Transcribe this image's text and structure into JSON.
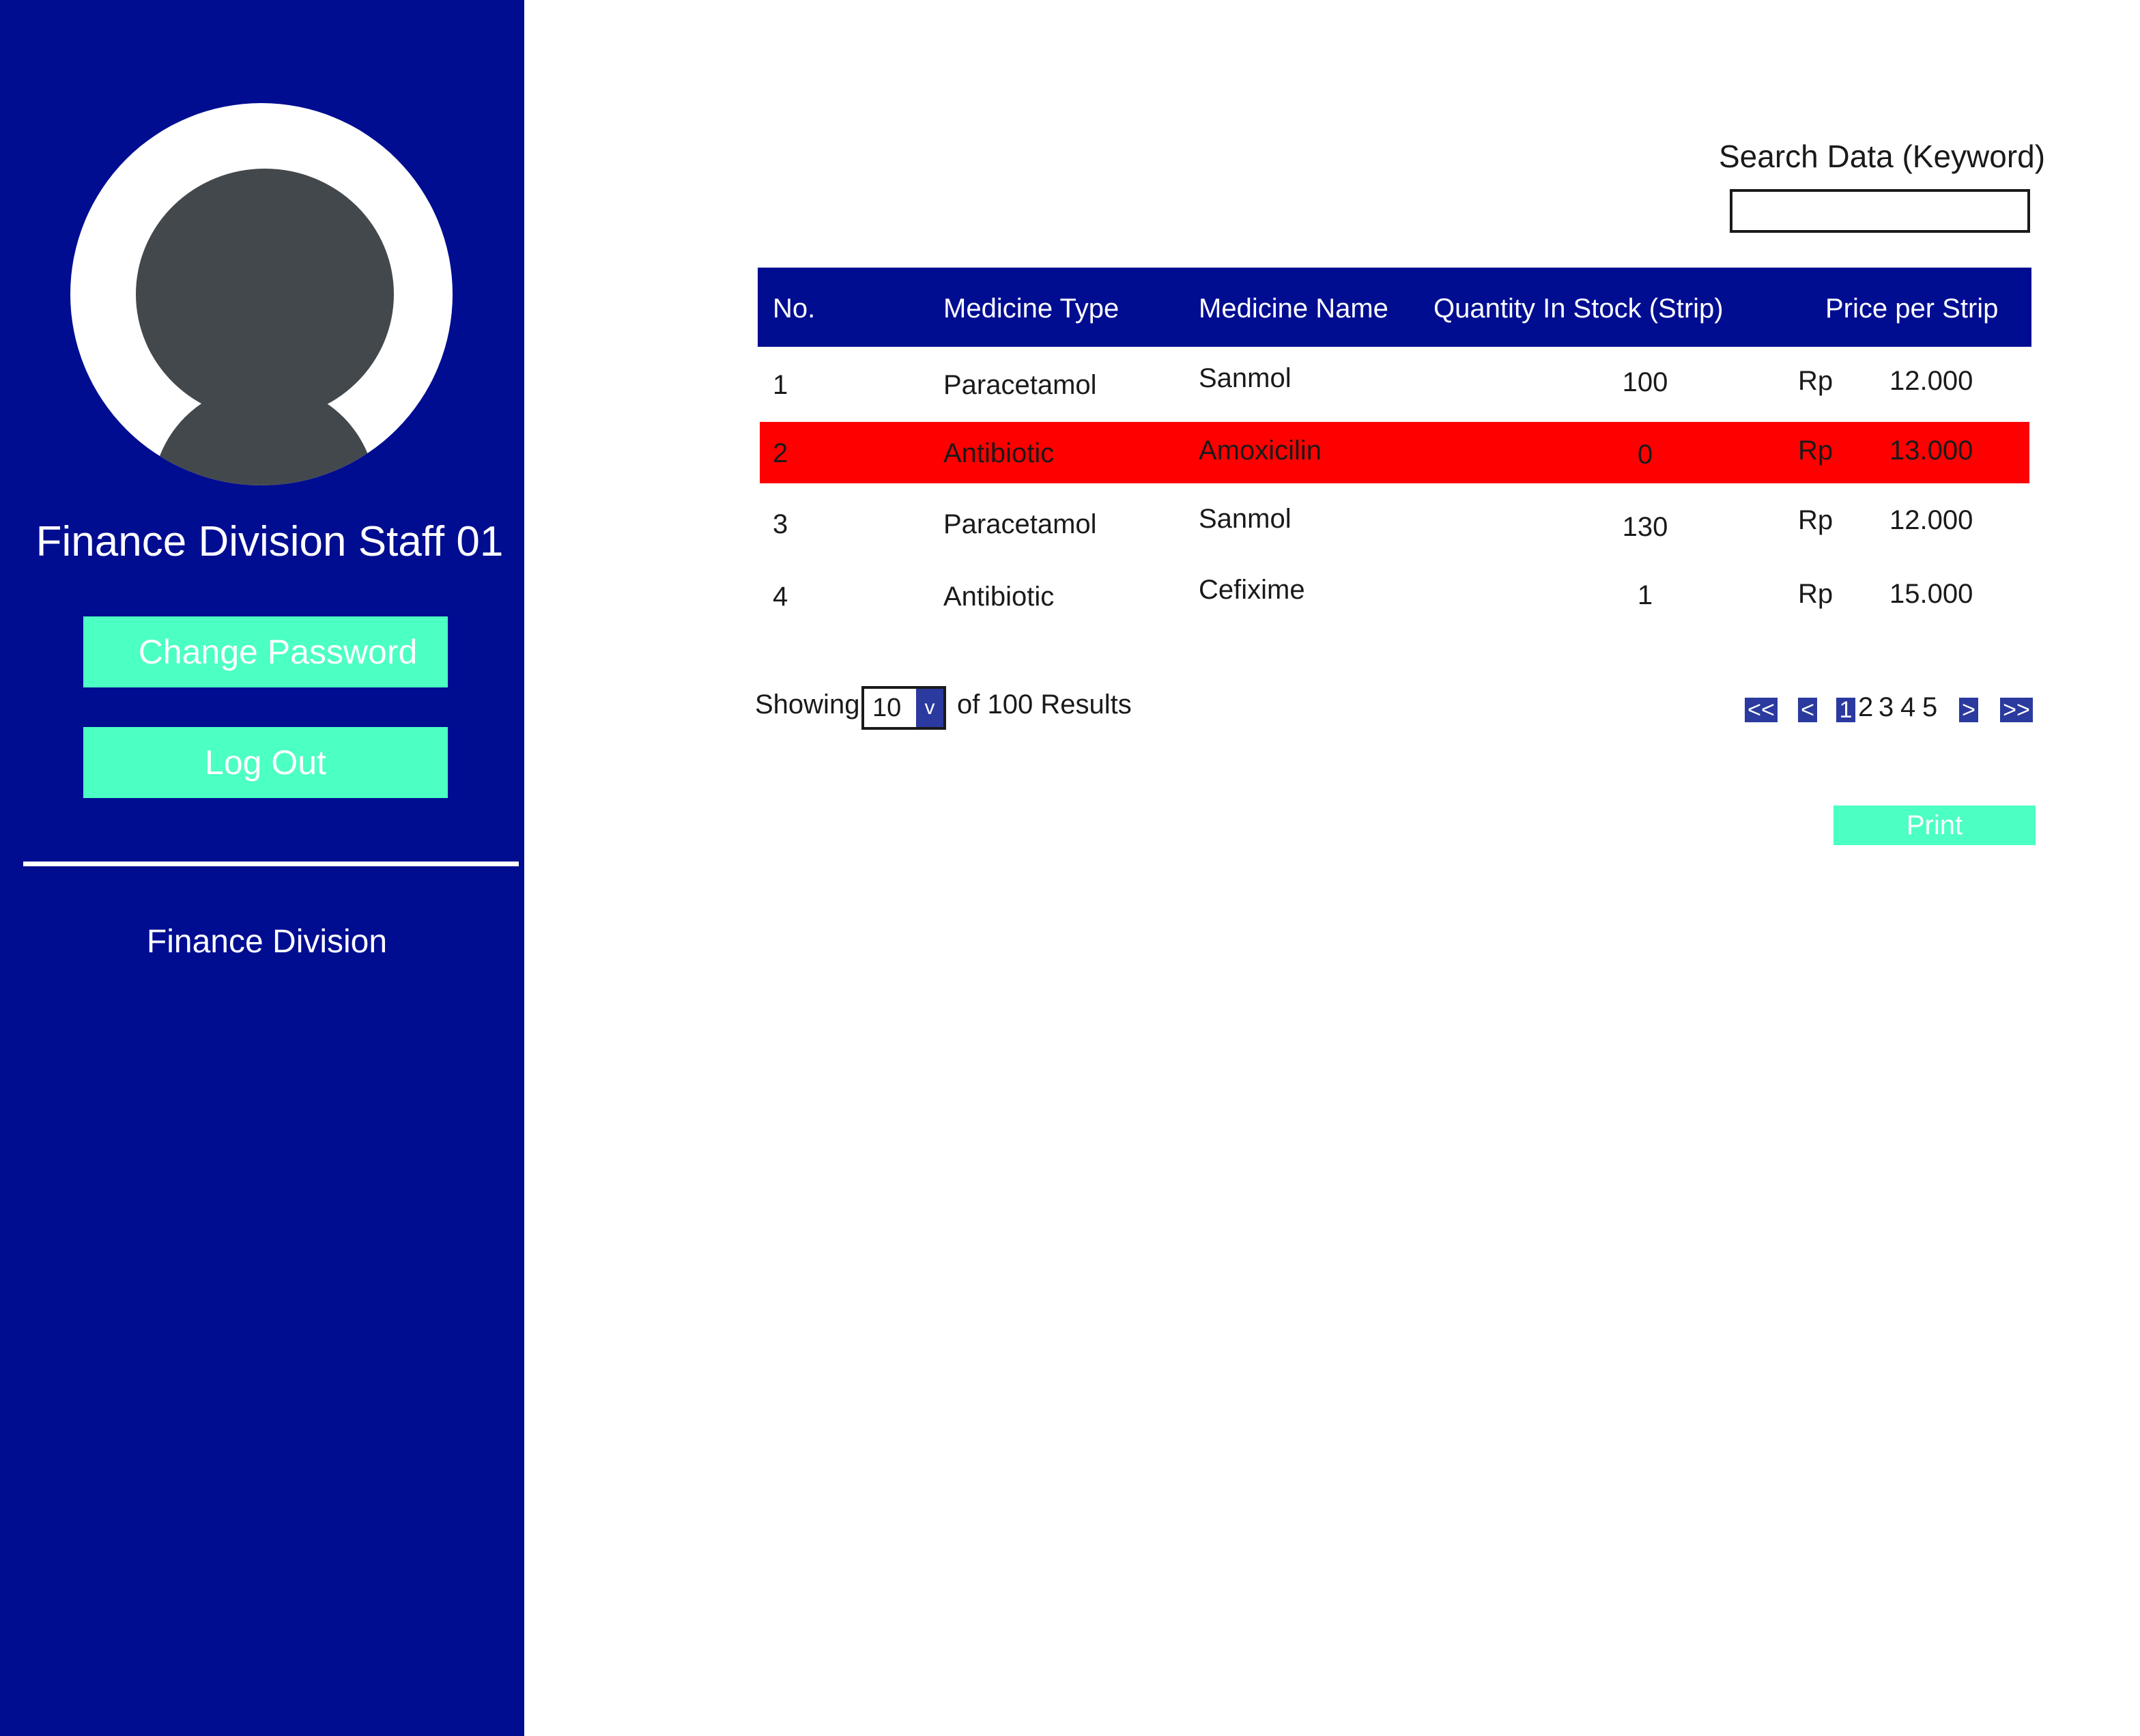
{
  "sidebar": {
    "staff_name": "Finance Division Staff 01",
    "change_password_label": "Change Password",
    "logout_label": "Log Out",
    "division_label": "Finance Division",
    "avatar_icon": "user-avatar-icon"
  },
  "search": {
    "label": "Search Data (Keyword)",
    "value": "",
    "placeholder": ""
  },
  "table": {
    "headers": {
      "no": "No.",
      "type": "Medicine Type",
      "name": "Medicine Name",
      "qty": "Quantity In Stock (Strip)",
      "price": "Price per Strip"
    },
    "rows": [
      {
        "no": "1",
        "type": "Paracetamol",
        "name": "Sanmol",
        "qty": "100",
        "currency": "Rp",
        "price": "12.000"
      },
      {
        "no": "2",
        "type": "Antibiotic",
        "name": "Amoxicilin",
        "qty": "0",
        "currency": "Rp",
        "price": "13.000"
      },
      {
        "no": "3",
        "type": "Paracetamol",
        "name": "Sanmol",
        "qty": "130",
        "currency": "Rp",
        "price": "12.000"
      },
      {
        "no": "4",
        "type": "Antibiotic",
        "name": "Cefixime",
        "qty": "1",
        "currency": "Rp",
        "price": "15.000"
      }
    ]
  },
  "pagination": {
    "showing_label": "Showing",
    "page_size": "10",
    "dropdown_arrow": "v",
    "results_label": "of 100 Results",
    "first": "<<",
    "prev": "<",
    "pages": [
      "1",
      "2",
      "3",
      "4",
      "5"
    ],
    "current_page": "1",
    "next": ">",
    "last": ">>"
  },
  "print_label": "Print",
  "colors": {
    "sidebar_bg": "#000d91",
    "accent_button": "#4cffc2",
    "alert_row": "#ff0000",
    "pager_bg": "#2b3a9e"
  }
}
